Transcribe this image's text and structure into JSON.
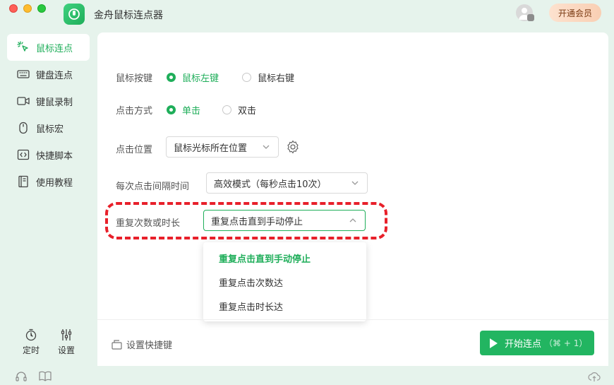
{
  "app": {
    "title": "金舟鼠标连点器",
    "vip_label": "开通会员",
    "accent": "#1fae5a"
  },
  "sidebar": {
    "items": [
      {
        "label": "鼠标连点",
        "icon": "cursor-click-icon",
        "active": true
      },
      {
        "label": "键盘连点",
        "icon": "keyboard-icon",
        "active": false
      },
      {
        "label": "键鼠录制",
        "icon": "video-record-icon",
        "active": false
      },
      {
        "label": "鼠标宏",
        "icon": "mouse-icon",
        "active": false
      },
      {
        "label": "快捷脚本",
        "icon": "code-icon",
        "active": false
      },
      {
        "label": "使用教程",
        "icon": "book-icon",
        "active": false
      }
    ],
    "timer_label": "定时",
    "settings_label": "设置"
  },
  "form": {
    "mouse_button": {
      "label": "鼠标按键",
      "options": [
        "鼠标左键",
        "鼠标右键"
      ],
      "selected": 0
    },
    "click_type": {
      "label": "点击方式",
      "options": [
        "单击",
        "双击"
      ],
      "selected": 0
    },
    "click_position": {
      "label": "点击位置",
      "value": "鼠标光标所在位置"
    },
    "interval": {
      "label": "每次点击间隔时间",
      "value": "高效模式（每秒点击10次）"
    },
    "repeat": {
      "label": "重复次数或时长",
      "value": "重复点击直到手动停止",
      "options": [
        "重复点击直到手动停止",
        "重复点击次数达",
        "重复点击时长达"
      ],
      "selected": 0
    }
  },
  "footer": {
    "shortcut_label": "设置快捷键",
    "start_label": "开始连点",
    "start_hotkey": "（⌘ + 1）"
  }
}
